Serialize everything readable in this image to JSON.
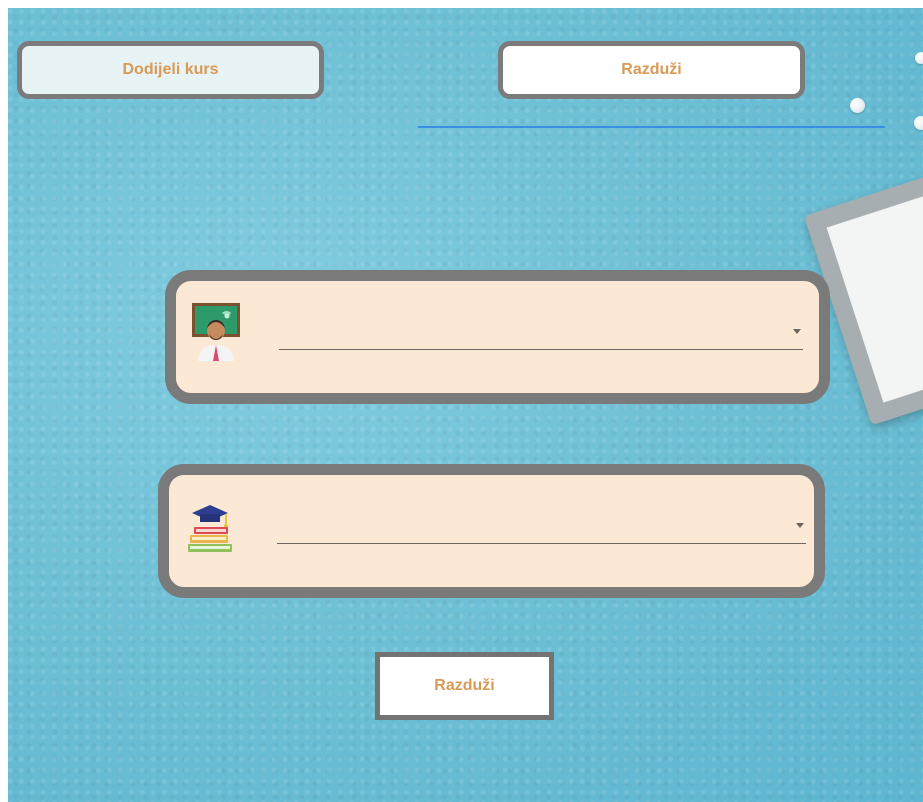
{
  "tabs": {
    "assign_label": "Dodijeli kurs",
    "unassign_label": "Razduži",
    "active": "unassign"
  },
  "form": {
    "teacher_select": {
      "icon": "teacher-icon",
      "value": ""
    },
    "course_select": {
      "icon": "course-books-icon",
      "value": ""
    },
    "submit_label": "Razduži"
  },
  "colors": {
    "accent_text": "#d89a55",
    "tab_underline": "#3b8fe3",
    "field_background": "#fbe9d5",
    "border": "#7a7a7a",
    "page_background": "#6fc0d6"
  }
}
